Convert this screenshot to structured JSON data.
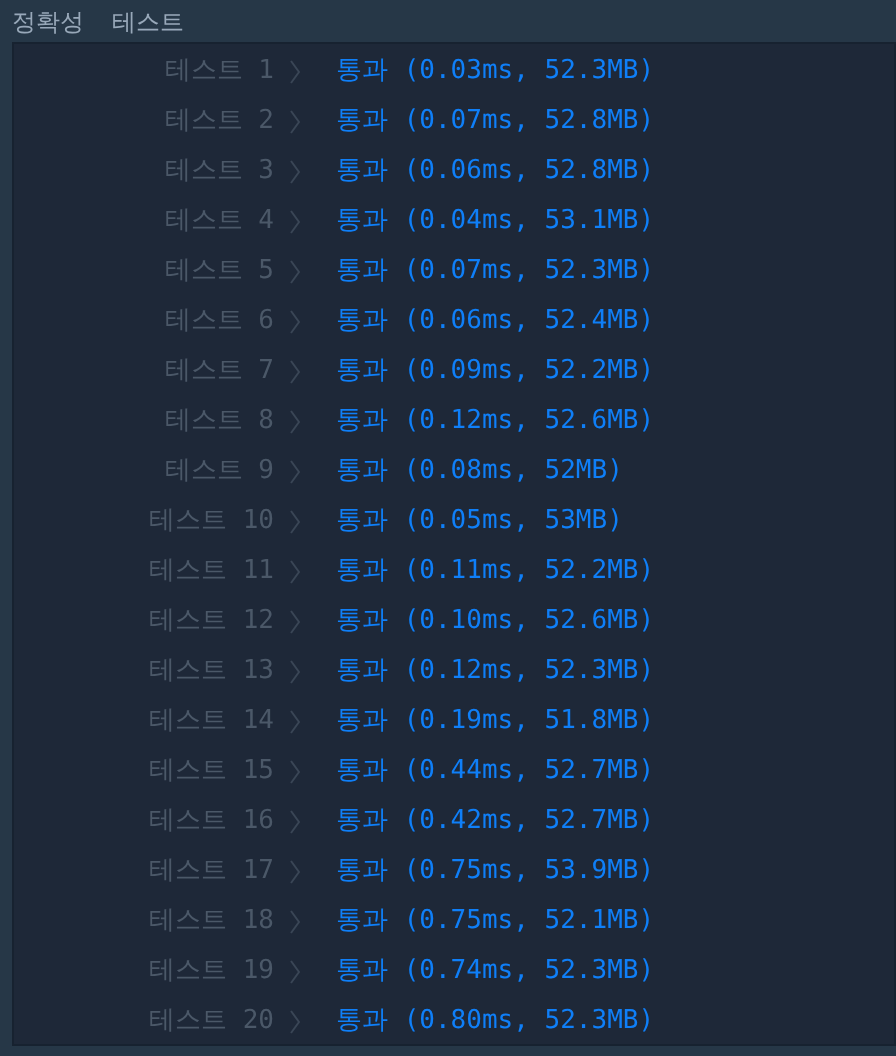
{
  "tabs": [
    {
      "label": "정확성",
      "selected": false
    },
    {
      "label": "테스트",
      "selected": false
    }
  ],
  "results": [
    {
      "label": "테스트 1",
      "result": "통과 (0.03ms, 52.3MB)"
    },
    {
      "label": "테스트 2",
      "result": "통과 (0.07ms, 52.8MB)"
    },
    {
      "label": "테스트 3",
      "result": "통과 (0.06ms, 52.8MB)"
    },
    {
      "label": "테스트 4",
      "result": "통과 (0.04ms, 53.1MB)"
    },
    {
      "label": "테스트 5",
      "result": "통과 (0.07ms, 52.3MB)"
    },
    {
      "label": "테스트 6",
      "result": "통과 (0.06ms, 52.4MB)"
    },
    {
      "label": "테스트 7",
      "result": "통과 (0.09ms, 52.2MB)"
    },
    {
      "label": "테스트 8",
      "result": "통과 (0.12ms, 52.6MB)"
    },
    {
      "label": "테스트 9",
      "result": "통과 (0.08ms, 52MB)"
    },
    {
      "label": "테스트 10",
      "result": "통과 (0.05ms, 53MB)"
    },
    {
      "label": "테스트 11",
      "result": "통과 (0.11ms, 52.2MB)"
    },
    {
      "label": "테스트 12",
      "result": "통과 (0.10ms, 52.6MB)"
    },
    {
      "label": "테스트 13",
      "result": "통과 (0.12ms, 52.3MB)"
    },
    {
      "label": "테스트 14",
      "result": "통과 (0.19ms, 51.8MB)"
    },
    {
      "label": "테스트 15",
      "result": "통과 (0.44ms, 52.7MB)"
    },
    {
      "label": "테스트 16",
      "result": "통과 (0.42ms, 52.7MB)"
    },
    {
      "label": "테스트 17",
      "result": "통과 (0.75ms, 53.9MB)"
    },
    {
      "label": "테스트 18",
      "result": "통과 (0.75ms, 52.1MB)"
    },
    {
      "label": "테스트 19",
      "result": "통과 (0.74ms, 52.3MB)"
    },
    {
      "label": "테스트 20",
      "result": "통과 (0.80ms, 52.3MB)"
    }
  ]
}
